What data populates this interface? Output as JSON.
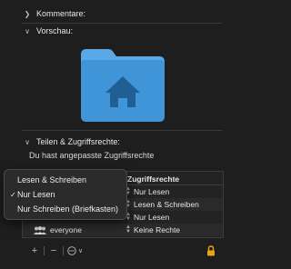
{
  "sections": {
    "comments": {
      "label": "Kommentare:"
    },
    "preview": {
      "label": "Vorschau:"
    },
    "sharing": {
      "label": "Teilen & Zugriffsrechte:"
    }
  },
  "sharing_status": "Du hast angepasste Zugriffsrechte",
  "table": {
    "header_privilege": "Zugriffsrechte",
    "rows": [
      {
        "name": "",
        "privilege": "Nur Lesen"
      },
      {
        "name": "",
        "privilege": "Lesen & Schreiben"
      },
      {
        "name": "",
        "privilege": "Nur Lesen"
      },
      {
        "name": "everyone",
        "privilege": "Keine Rechte"
      }
    ]
  },
  "popup_menu": {
    "items": [
      {
        "label": "Lesen & Schreiben",
        "checked": false
      },
      {
        "label": "Nur Lesen",
        "checked": true
      },
      {
        "label": "Nur Schreiben (Briefkasten)",
        "checked": false
      }
    ]
  },
  "toolbar": {
    "add_symbol": "+",
    "remove_symbol": "−"
  },
  "colors": {
    "background": "#1e1e1e",
    "folder_blue": "#3f95d8",
    "lock_yellow": "#e9a31b"
  }
}
